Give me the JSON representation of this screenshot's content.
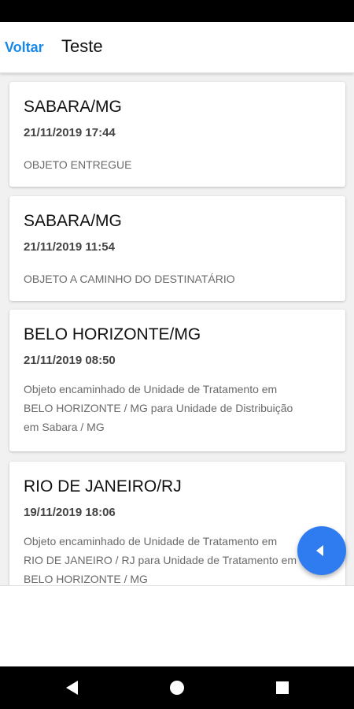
{
  "header": {
    "back_label": "Voltar",
    "title": "Teste"
  },
  "events": [
    {
      "city": "SABARA/MG",
      "date": "21/11/2019 17:44",
      "desc": [
        "OBJETO ENTREGUE"
      ]
    },
    {
      "city": "SABARA/MG",
      "date": "21/11/2019 11:54",
      "desc": [
        "OBJETO A CAMINHO DO DESTINATÁRIO"
      ]
    },
    {
      "city": "BELO HORIZONTE/MG",
      "date": "21/11/2019 08:50",
      "desc": [
        "Objeto encaminhado de Unidade de Tratamento em",
        "BELO HORIZONTE / MG para Unidade de Distribuição",
        "em Sabara / MG"
      ]
    },
    {
      "city": "RIO DE JANEIRO/RJ",
      "date": "19/11/2019 18:06",
      "desc": [
        "Objeto encaminhado de Unidade de Tratamento em",
        "RIO DE JANEIRO / RJ para Unidade de Tratamento em",
        "BELO HORIZONTE / MG"
      ]
    }
  ],
  "icons": {
    "fab": "chevron-left-icon",
    "nav_back": "triangle-back-icon",
    "nav_home": "circle-home-icon",
    "nav_recent": "square-recent-icon"
  },
  "colors": {
    "accent": "#1a88e6",
    "fab": "#2f7cf0"
  }
}
